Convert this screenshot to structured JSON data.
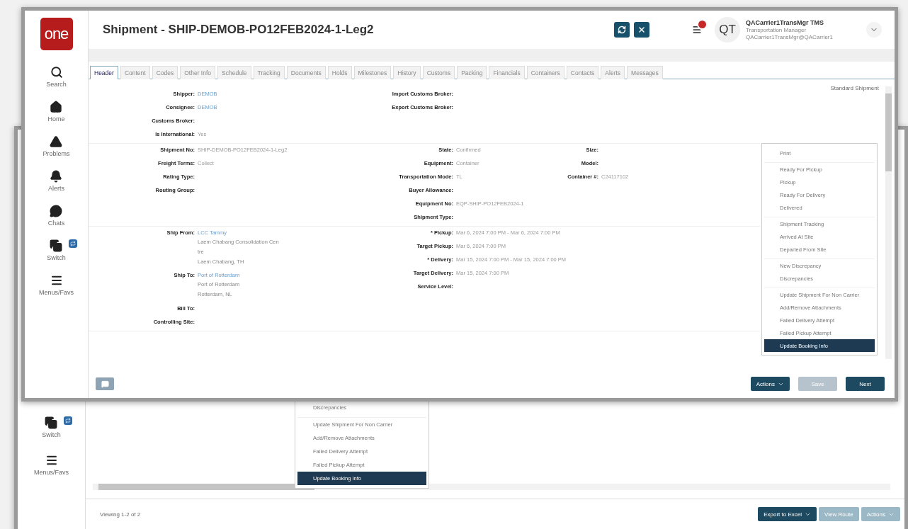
{
  "back_window": {
    "sidebar": [
      {
        "kind": "switch",
        "label": "Switch"
      },
      {
        "kind": "menu",
        "label": "Menus/Favs"
      }
    ],
    "menu": {
      "items": [
        {
          "label": "Discrepancies",
          "selected": false,
          "group_start": false
        },
        {
          "label": "Update Shipment For Non Carrier",
          "selected": false,
          "group_start": true
        },
        {
          "label": "Add/Remove Attachments",
          "selected": false,
          "group_start": false
        },
        {
          "label": "Failed Delivery Attempt",
          "selected": false,
          "group_start": false
        },
        {
          "label": "Failed Pickup Attempt",
          "selected": false,
          "group_start": false
        },
        {
          "label": "Update Booking Info",
          "selected": true,
          "group_start": false
        }
      ]
    },
    "footer": {
      "status": "Viewing 1-2 of 2",
      "buttons": [
        {
          "label": "Export to Excel",
          "caret": true,
          "disabled": false
        },
        {
          "label": "View Route",
          "caret": false,
          "disabled": true
        },
        {
          "label": "Actions",
          "caret": true,
          "disabled": true
        }
      ]
    }
  },
  "window": {
    "title": "Shipment - SHIP-DEMOB-PO12FEB2024-1-Leg2",
    "logo": "one",
    "user": {
      "initials": "QT",
      "name": "QACarrier1TransMgr TMS",
      "role": "Transportation Manager",
      "email": "QACarrier1TransMgr@QACarrier1"
    },
    "sidebar": [
      {
        "kind": "search",
        "label": "Search"
      },
      {
        "kind": "home",
        "label": "Home"
      },
      {
        "kind": "problems",
        "label": "Problems"
      },
      {
        "kind": "alerts",
        "label": "Alerts"
      },
      {
        "kind": "chats",
        "label": "Chats"
      },
      {
        "kind": "switch",
        "label": "Switch"
      },
      {
        "kind": "menu",
        "label": "Menus/Favs"
      }
    ],
    "tabs": [
      {
        "label": "Header",
        "selected": true
      },
      {
        "label": "Content",
        "selected": false
      },
      {
        "label": "Codes",
        "selected": false
      },
      {
        "label": "Other Info",
        "selected": false
      },
      {
        "label": "Schedule",
        "selected": false
      },
      {
        "label": "Tracking",
        "selected": false
      },
      {
        "label": "Documents",
        "selected": false
      },
      {
        "label": "Holds",
        "selected": false
      },
      {
        "label": "Milestones",
        "selected": false
      },
      {
        "label": "History",
        "selected": false
      },
      {
        "label": "Customs",
        "selected": false
      },
      {
        "label": "Packing",
        "selected": false
      },
      {
        "label": "Financials",
        "selected": false
      },
      {
        "label": "Containers",
        "selected": false
      },
      {
        "label": "Contacts",
        "selected": false
      },
      {
        "label": "Alerts",
        "selected": false
      },
      {
        "label": "Messages",
        "selected": false
      }
    ],
    "shipment_type": "Standard Shipment",
    "sections": [
      {
        "columns": [
          [
            {
              "label": "Shipper:",
              "value": "DEMOB",
              "link": true
            },
            {
              "label": "Consignee:",
              "value": "DEMOB",
              "link": true
            },
            {
              "label": "Customs Broker:"
            },
            {
              "label": "Is International:",
              "value": "Yes",
              "link": false
            }
          ],
          [
            {
              "label": "Import Customs Broker:"
            },
            {
              "label": "Export Customs Broker:"
            }
          ]
        ]
      },
      {
        "columns": [
          [
            {
              "label": "Shipment No:",
              "value": "SHIP-DEMOB-PO12FEB2024-1-Leg2",
              "link": false
            },
            {
              "label": "Freight Terms:",
              "value": "Collect",
              "link": false
            },
            {
              "label": "Rating Type:"
            },
            {
              "label": "Routing Group:"
            }
          ],
          [
            {
              "label": "State:",
              "value": "Confirmed",
              "link": false
            },
            {
              "label": "Equipment:",
              "value": "Container",
              "link": false
            },
            {
              "label": "Transportation Mode:",
              "value": "TL",
              "link": false
            },
            {
              "label": "Buyer Allowance:"
            },
            {
              "label": "Equipment No:",
              "value": "EQP-SHIP-PO12FEB2024-1",
              "link": false
            },
            {
              "label": "Shipment Type:"
            }
          ],
          [
            {
              "label": "Size:"
            },
            {
              "label": "Model:"
            },
            {
              "label": "Container #:",
              "value": "C24117102",
              "link": false
            }
          ]
        ]
      },
      {
        "columns": [
          [
            {
              "label": "Ship From:",
              "value": "LCC Tammy",
              "link": true,
              "address": [
                "Laem Chabang Consolidation Cen",
                "tre",
                "Laem Chabang, TH"
              ]
            },
            {
              "label": "Ship To:",
              "value": "Port of Rotterdam",
              "link": true,
              "address": [
                "Port of Rotterdam",
                "Rotterdam, NL"
              ]
            },
            {
              "label": "Bill To:"
            },
            {
              "label": "Controlling Site:"
            }
          ],
          [
            {
              "label": "* Pickup:",
              "value": "Mar 6, 2024 7:00 PM - Mar 6, 2024 7:00 PM",
              "link": false
            },
            {
              "label": "Target Pickup:",
              "value": "Mar 6, 2024 7:00 PM",
              "link": false
            },
            {
              "label": "* Delivery:",
              "value": "Mar 15, 2024 7:00 PM - Mar 15, 2024 7:00 PM",
              "link": false
            },
            {
              "label": "Target Delivery:",
              "value": "Mar 15, 2024 7:00 PM",
              "link": false
            },
            {
              "label": "Service Level:"
            }
          ]
        ]
      }
    ],
    "menu": {
      "items": [
        {
          "label": "Print",
          "selected": false,
          "group_start": false
        },
        {
          "label": "Ready For Pickup",
          "selected": false,
          "group_start": true
        },
        {
          "label": "Pickup",
          "selected": false,
          "group_start": false
        },
        {
          "label": "Ready For Delivery",
          "selected": false,
          "group_start": false
        },
        {
          "label": "Delivered",
          "selected": false,
          "group_start": false
        },
        {
          "label": "Shipment Tracking",
          "selected": false,
          "group_start": true
        },
        {
          "label": "Arrived At Site",
          "selected": false,
          "group_start": false
        },
        {
          "label": "Departed From Site",
          "selected": false,
          "group_start": false
        },
        {
          "label": "New Discrepancy",
          "selected": false,
          "group_start": true
        },
        {
          "label": "Discrepancies",
          "selected": false,
          "group_start": false
        },
        {
          "label": "Update Shipment For Non Carrier",
          "selected": false,
          "group_start": true
        },
        {
          "label": "Add/Remove Attachments",
          "selected": false,
          "group_start": false
        },
        {
          "label": "Failed Delivery Attempt",
          "selected": false,
          "group_start": false
        },
        {
          "label": "Failed Pickup Attempt",
          "selected": false,
          "group_start": false
        },
        {
          "label": "Update Booking Info",
          "selected": true,
          "group_start": false
        }
      ]
    },
    "buttons": [
      {
        "label": "Actions",
        "caret": true,
        "disabled": false
      },
      {
        "label": "Save",
        "caret": false,
        "disabled": true
      },
      {
        "label": "Next",
        "caret": false,
        "disabled": false
      }
    ]
  }
}
